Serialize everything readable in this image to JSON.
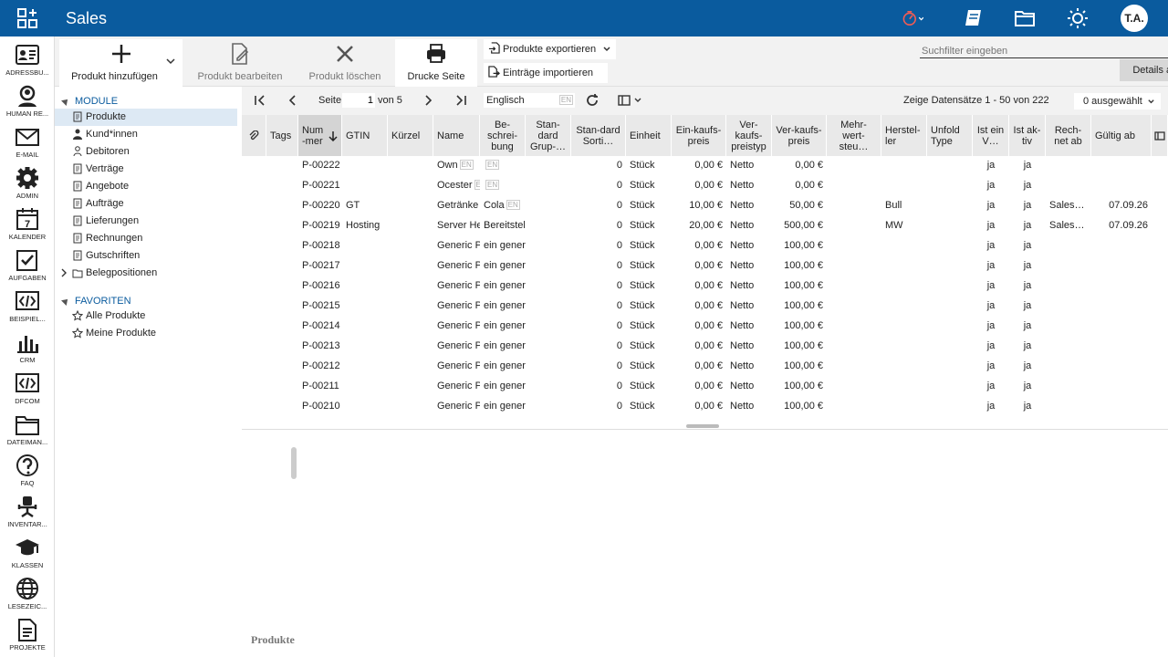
{
  "app": {
    "title": "Sales",
    "avatar": "T.A."
  },
  "nav": [
    {
      "label": "ADRESSBU...",
      "icon": "address-book-icon"
    },
    {
      "label": "HUMAN RE...",
      "icon": "person-icon"
    },
    {
      "label": "E-MAIL",
      "icon": "envelope-icon"
    },
    {
      "label": "ADMIN",
      "icon": "gear-icon"
    },
    {
      "label": "KALENDER",
      "icon": "calendar-icon"
    },
    {
      "label": "AUFGABEN",
      "icon": "checkbox-icon"
    },
    {
      "label": "BEISPIEL...",
      "icon": "code-icon"
    },
    {
      "label": "CRM",
      "icon": "bar-chart-icon"
    },
    {
      "label": "DFCOM",
      "icon": "code-icon"
    },
    {
      "label": "DATEIMAN...",
      "icon": "folder-icon"
    },
    {
      "label": "FAQ",
      "icon": "question-icon"
    },
    {
      "label": "INVENTAR...",
      "icon": "chair-icon"
    },
    {
      "label": "KLASSEN",
      "icon": "graduation-cap-icon"
    },
    {
      "label": "LESEZEIC...",
      "icon": "globe-icon"
    },
    {
      "label": "PROJEKTE",
      "icon": "document-icon"
    }
  ],
  "toolbar": {
    "add": "Produkt hinzufügen",
    "edit": "Produkt bearbeiten",
    "delete": "Produkt löschen",
    "print": "Drucke Seite",
    "export": "Produkte exportieren",
    "import": "Einträge importieren",
    "search_placeholder": "Suchfilter eingeben",
    "details": "Details anzeigen"
  },
  "tree": {
    "modules_title": "MODULE",
    "modules": [
      "Produkte",
      "Kund*innen",
      "Debitoren",
      "Verträge",
      "Angebote",
      "Aufträge",
      "Lieferungen",
      "Rechnungen",
      "Gutschriften",
      "Belegpositionen"
    ],
    "favorites_title": "FAVORITEN",
    "favorites": [
      "Alle Produkte",
      "Meine Produkte"
    ]
  },
  "pager": {
    "page_label": "Seite",
    "page": "1",
    "of": "von 5",
    "language": "Englisch",
    "lang_badge": "EN",
    "records": "Zeige Datensätze 1 - 50 von 222",
    "selected": "0 ausgewählt"
  },
  "grid": {
    "columns": [
      "Tags",
      "Num-mer",
      "GTIN",
      "Kürzel",
      "Name",
      "Be-schrei-bung",
      "Stan-dard Grup-…",
      "Stan-dard Sorti…",
      "Einheit",
      "Ein-kaufs-preis",
      "Ver-kaufs-preistyp",
      "Ver-kaufs-preis",
      "Mehr-wert-steu…",
      "Herstel-ler",
      "Unfold Type",
      "Ist ein V…",
      "Ist ak-tiv",
      "Rech-net ab",
      "Gültig ab"
    ],
    "rows": [
      [
        "P-00222",
        "",
        "",
        "Own",
        "",
        "0",
        "Stück",
        "0,00 €",
        "Netto",
        "0,00 €",
        "",
        "ja",
        "ja",
        "",
        ""
      ],
      [
        "P-00221",
        "",
        "",
        "Ocester",
        "",
        "0",
        "Stück",
        "0,00 €",
        "Netto",
        "0,00 €",
        "",
        "ja",
        "ja",
        "",
        ""
      ],
      [
        "P-00220",
        "GT",
        "",
        "Getränke",
        "Cola",
        "0",
        "Stück",
        "10,00 €",
        "Netto",
        "50,00 €",
        "Bull",
        "ja",
        "ja",
        "Sales…",
        "07.09.26"
      ],
      [
        "P-00219",
        "Hosting",
        "",
        "Server He",
        "Bereitstel",
        "0",
        "Stück",
        "20,00 €",
        "Netto",
        "500,00 €",
        "MW",
        "ja",
        "ja",
        "Sales…",
        "07.09.26"
      ],
      [
        "P-00218",
        "",
        "",
        "Generic P",
        "ein gener",
        "0",
        "Stück",
        "0,00 €",
        "Netto",
        "100,00 €",
        "",
        "ja",
        "ja",
        "",
        ""
      ],
      [
        "P-00217",
        "",
        "",
        "Generic P",
        "ein gener",
        "0",
        "Stück",
        "0,00 €",
        "Netto",
        "100,00 €",
        "",
        "ja",
        "ja",
        "",
        ""
      ],
      [
        "P-00216",
        "",
        "",
        "Generic P",
        "ein gener",
        "0",
        "Stück",
        "0,00 €",
        "Netto",
        "100,00 €",
        "",
        "ja",
        "ja",
        "",
        ""
      ],
      [
        "P-00215",
        "",
        "",
        "Generic P",
        "ein gener",
        "0",
        "Stück",
        "0,00 €",
        "Netto",
        "100,00 €",
        "",
        "ja",
        "ja",
        "",
        ""
      ],
      [
        "P-00214",
        "",
        "",
        "Generic P",
        "ein gener",
        "0",
        "Stück",
        "0,00 €",
        "Netto",
        "100,00 €",
        "",
        "ja",
        "ja",
        "",
        ""
      ],
      [
        "P-00213",
        "",
        "",
        "Generic P",
        "ein gener",
        "0",
        "Stück",
        "0,00 €",
        "Netto",
        "100,00 €",
        "",
        "ja",
        "ja",
        "",
        ""
      ],
      [
        "P-00212",
        "",
        "",
        "Generic P",
        "ein gener",
        "0",
        "Stück",
        "0,00 €",
        "Netto",
        "100,00 €",
        "",
        "ja",
        "ja",
        "",
        ""
      ],
      [
        "P-00211",
        "",
        "",
        "Generic P",
        "ein gener",
        "0",
        "Stück",
        "0,00 €",
        "Netto",
        "100,00 €",
        "",
        "ja",
        "ja",
        "",
        ""
      ],
      [
        "P-00210",
        "",
        "",
        "Generic P",
        "ein gener",
        "0",
        "Stück",
        "0,00 €",
        "Netto",
        "100,00 €",
        "",
        "ja",
        "ja",
        "",
        ""
      ]
    ]
  },
  "status": "Produkte"
}
